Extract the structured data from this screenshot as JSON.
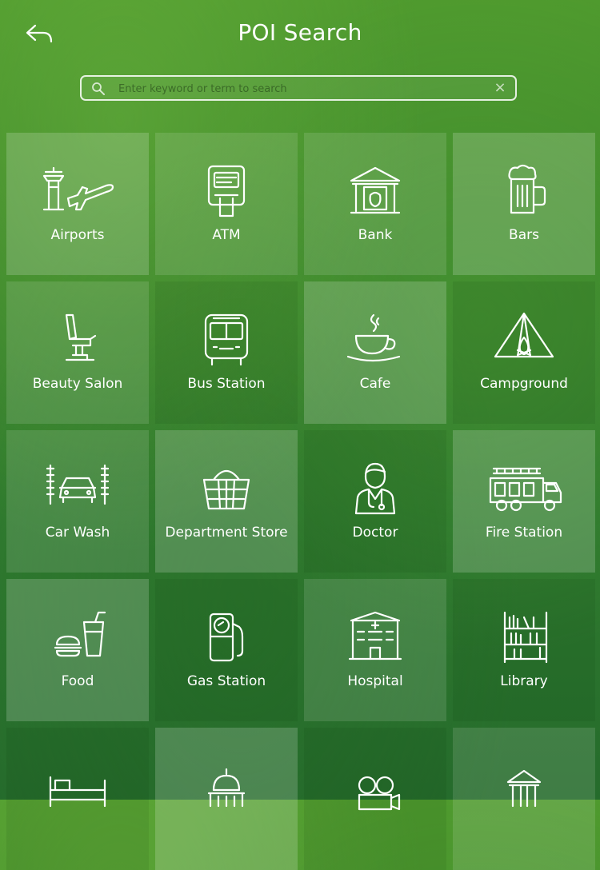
{
  "header": {
    "title": "POI Search",
    "back_icon": "back-arrow-icon"
  },
  "search": {
    "placeholder": "Enter keyword or term to search",
    "value": "",
    "icon": "search-icon",
    "clear_icon": "clear-icon"
  },
  "colors": {
    "background": "#3f8a2c",
    "text": "#ffffff"
  },
  "categories": [
    {
      "label": "Airports",
      "icon": "airport-icon"
    },
    {
      "label": "ATM",
      "icon": "atm-icon"
    },
    {
      "label": "Bank",
      "icon": "bank-icon"
    },
    {
      "label": "Bars",
      "icon": "beer-mug-icon"
    },
    {
      "label": "Beauty Salon",
      "icon": "salon-chair-icon"
    },
    {
      "label": "Bus Station",
      "icon": "bus-icon"
    },
    {
      "label": "Cafe",
      "icon": "coffee-cup-icon"
    },
    {
      "label": "Campground",
      "icon": "tent-icon"
    },
    {
      "label": "Car Wash",
      "icon": "car-wash-icon"
    },
    {
      "label": "Department Store",
      "icon": "basket-icon"
    },
    {
      "label": "Doctor",
      "icon": "doctor-icon"
    },
    {
      "label": "Fire Station",
      "icon": "fire-truck-icon"
    },
    {
      "label": "Food",
      "icon": "burger-drink-icon"
    },
    {
      "label": "Gas Station",
      "icon": "gas-pump-icon"
    },
    {
      "label": "Hospital",
      "icon": "hospital-building-icon"
    },
    {
      "label": "Library",
      "icon": "bookshelf-icon"
    },
    {
      "label": "",
      "icon": "bed-icon"
    },
    {
      "label": "",
      "icon": "capitol-building-icon"
    },
    {
      "label": "",
      "icon": "movie-camera-icon"
    },
    {
      "label": "",
      "icon": "museum-icon"
    }
  ]
}
